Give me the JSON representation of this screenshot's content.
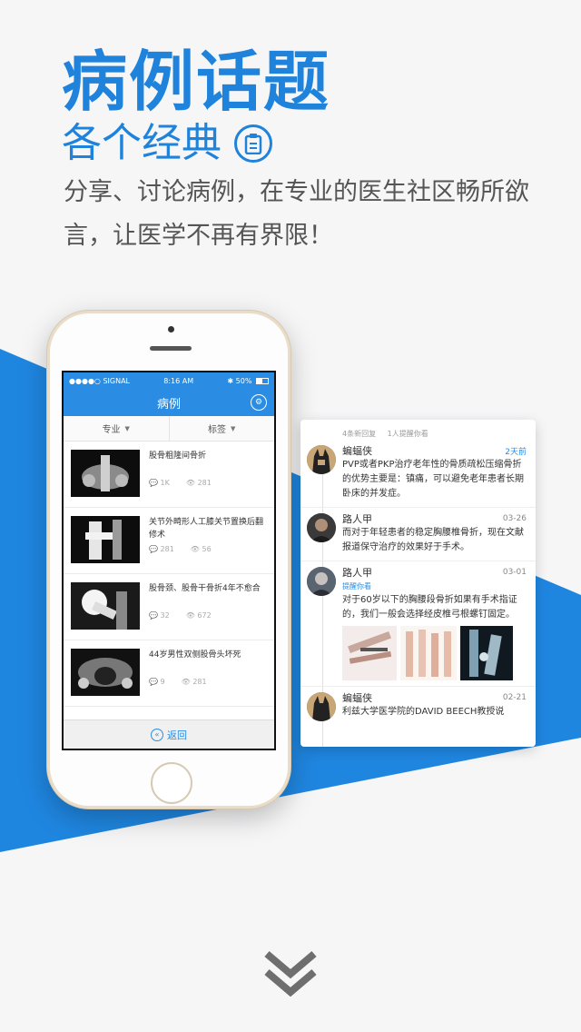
{
  "hero": {
    "title": "病例话题",
    "subtitle": "各个经典",
    "description": "分享、讨论病例，在专业的医生社区畅所欲言，让医学不再有界限！"
  },
  "colors": {
    "accent": "#1f83dc",
    "app_bar": "#2a8de3"
  },
  "phone": {
    "status": {
      "carrier": "●●●●○ SIGNAL",
      "wifi": "wifi-icon",
      "time": "8:16 AM",
      "bluetooth": "✱",
      "battery": "50%"
    },
    "nav_title": "病例",
    "filters": [
      {
        "label": "专业"
      },
      {
        "label": "标签"
      }
    ],
    "cases": [
      {
        "title": "股骨粗隆间骨折",
        "comments": "1K",
        "views": "281"
      },
      {
        "title": "关节外畸形人工膝关节置换后翻修术",
        "comments": "281",
        "views": "56"
      },
      {
        "title": "股骨颈、股骨干骨折4年不愈合",
        "comments": "32",
        "views": "672"
      },
      {
        "title": "44岁男性双侧股骨头坏死",
        "comments": "9",
        "views": "281"
      }
    ],
    "back_label": "返回"
  },
  "detail": {
    "reply_count": "4条新回复",
    "mention_count": "1人提醒你看",
    "replies": [
      {
        "name": "蝙蝠侠",
        "date": "2天前",
        "text": "PVP或者PKP治疗老年性的骨质疏松压缩骨折的优势主要是：镇痛，可以避免老年患者长期卧床的并发症。"
      },
      {
        "name": "路人甲",
        "date": "03-26",
        "text": "而对于年轻患者的稳定胸腰椎骨折，现在文献报道保守治疗的效果好于手术。"
      },
      {
        "name": "路人甲",
        "date": "03-01",
        "mention": "提醒你看",
        "text": "对于60岁以下的胸腰段骨折如果有手术指证的，我们一般会选择经皮椎弓根螺钉固定。"
      },
      {
        "name": "蝙蝠侠",
        "date": "02-21",
        "text": "利兹大学医学院的DAVID BEECH教授说"
      }
    ]
  }
}
